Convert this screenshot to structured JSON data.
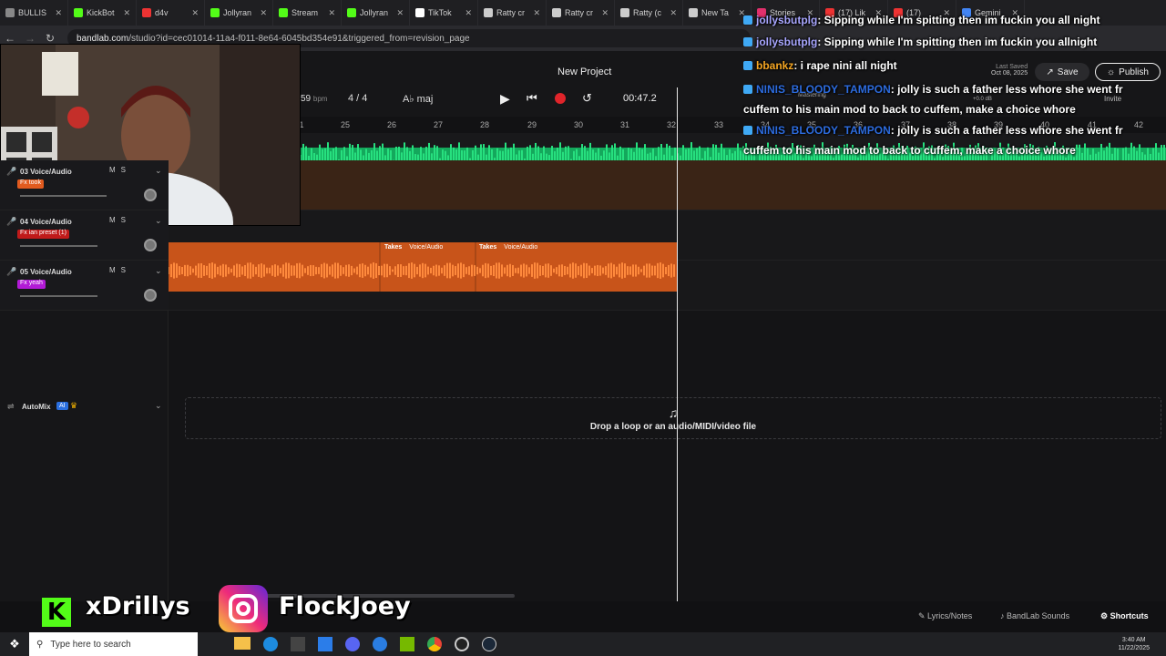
{
  "browser": {
    "tabs": [
      {
        "label": "BULLIS",
        "color": "#888"
      },
      {
        "label": "KickBot",
        "color": "#53fc18"
      },
      {
        "label": "d4v",
        "color": "#e33"
      },
      {
        "label": "Jollyran",
        "color": "#53fc18"
      },
      {
        "label": "Stream",
        "color": "#53fc18"
      },
      {
        "label": "Jollyran",
        "color": "#53fc18"
      },
      {
        "label": "TikTok",
        "color": "#fff"
      },
      {
        "label": "Ratty cr",
        "color": "#ccc"
      },
      {
        "label": "Ratty cr",
        "color": "#ccc"
      },
      {
        "label": "Ratty (c",
        "color": "#ccc"
      },
      {
        "label": "New Ta",
        "color": "#ccc"
      },
      {
        "label": "Stories",
        "color": "#e1306c"
      },
      {
        "label": "(17) Lik",
        "color": "#e33"
      },
      {
        "label": "(17)",
        "color": "#e33"
      },
      {
        "label": "Gemini",
        "color": "#4285f4"
      }
    ],
    "url_host": "bandlab.com",
    "url_path": "/studio?id=cec01014-11a4-f011-8e64-6045bd354e91&triggered_from=revision_page"
  },
  "studio": {
    "project_title": "New Project",
    "bpm_value": "59",
    "bpm_unit": "bpm",
    "time_signature": "4 / 4",
    "key": "A♭ maj",
    "time": "00:47.2",
    "last_saved_label": "Last Saved",
    "last_saved_date": "Oct 08, 2025",
    "save_label": "Save",
    "publish_label": "Publish",
    "mastering_label": "Mastering",
    "db_label": "+0.0 dB",
    "invite_label": "Invite",
    "ruler": [
      "1",
      "25",
      "26",
      "27",
      "28",
      "29",
      "30",
      "31",
      "32",
      "33",
      "34",
      "35",
      "36",
      "37",
      "38",
      "39",
      "40",
      "41",
      "42"
    ],
    "tracks": [
      {
        "name": "03 Voice/Audio",
        "fx": "Fx took",
        "fx_color": "#e25b1f"
      },
      {
        "name": "04 Voice/Audio",
        "fx": "Fx ian preset (1)",
        "fx_color": "#c01a1a"
      },
      {
        "name": "05 Voice/Audio",
        "fx": "Fx yeah",
        "fx_color": "#b21ad6"
      }
    ],
    "clips": [
      {
        "label": "Takes",
        "sub": "Voice/Audio"
      },
      {
        "label": "Takes",
        "sub": "Voice/Audio"
      }
    ],
    "automix_label": "AutoMix",
    "ai_label": "AI",
    "drop_text": "Drop a loop or an audio/MIDI/video file",
    "bottom_links": [
      "Lyrics/Notes",
      "BandLab Sounds",
      "Shortcuts"
    ]
  },
  "chat": [
    {
      "user": "jollysbutplg",
      "msg": ": Sipping while I'm spitting then im fuckin you all night"
    },
    {
      "user": "jollysbutplg",
      "msg": ": Sipping while I'm spitting then im fuckin you allnight"
    },
    {
      "user": "bbankz",
      "msg": ": i rape nini all night",
      "user_color": "#f5a623"
    },
    {
      "user": "NINIS_BLOODY_TAMPON",
      "msg": ": jolly is such a father less whore she went fr",
      "user_color": "#2d6cdf"
    },
    {
      "user": "",
      "msg": "cuffem to his main mod to back to cuffem, make a choice whore"
    },
    {
      "user": "NINIS_BLOODY_TAMPON",
      "msg": ": jolly is such a father less whore she went fr",
      "user_color": "#2d6cdf"
    },
    {
      "user": "",
      "msg": "cuffem to his main mod to back to cuffem, make a choice whore"
    }
  ],
  "overlay": {
    "kick_name": "xDrillys",
    "insta_name": "FlockJoey"
  },
  "taskbar": {
    "search_placeholder": "Type here to search",
    "clock_time": "3:40 AM",
    "clock_date": "11/22/2025"
  }
}
